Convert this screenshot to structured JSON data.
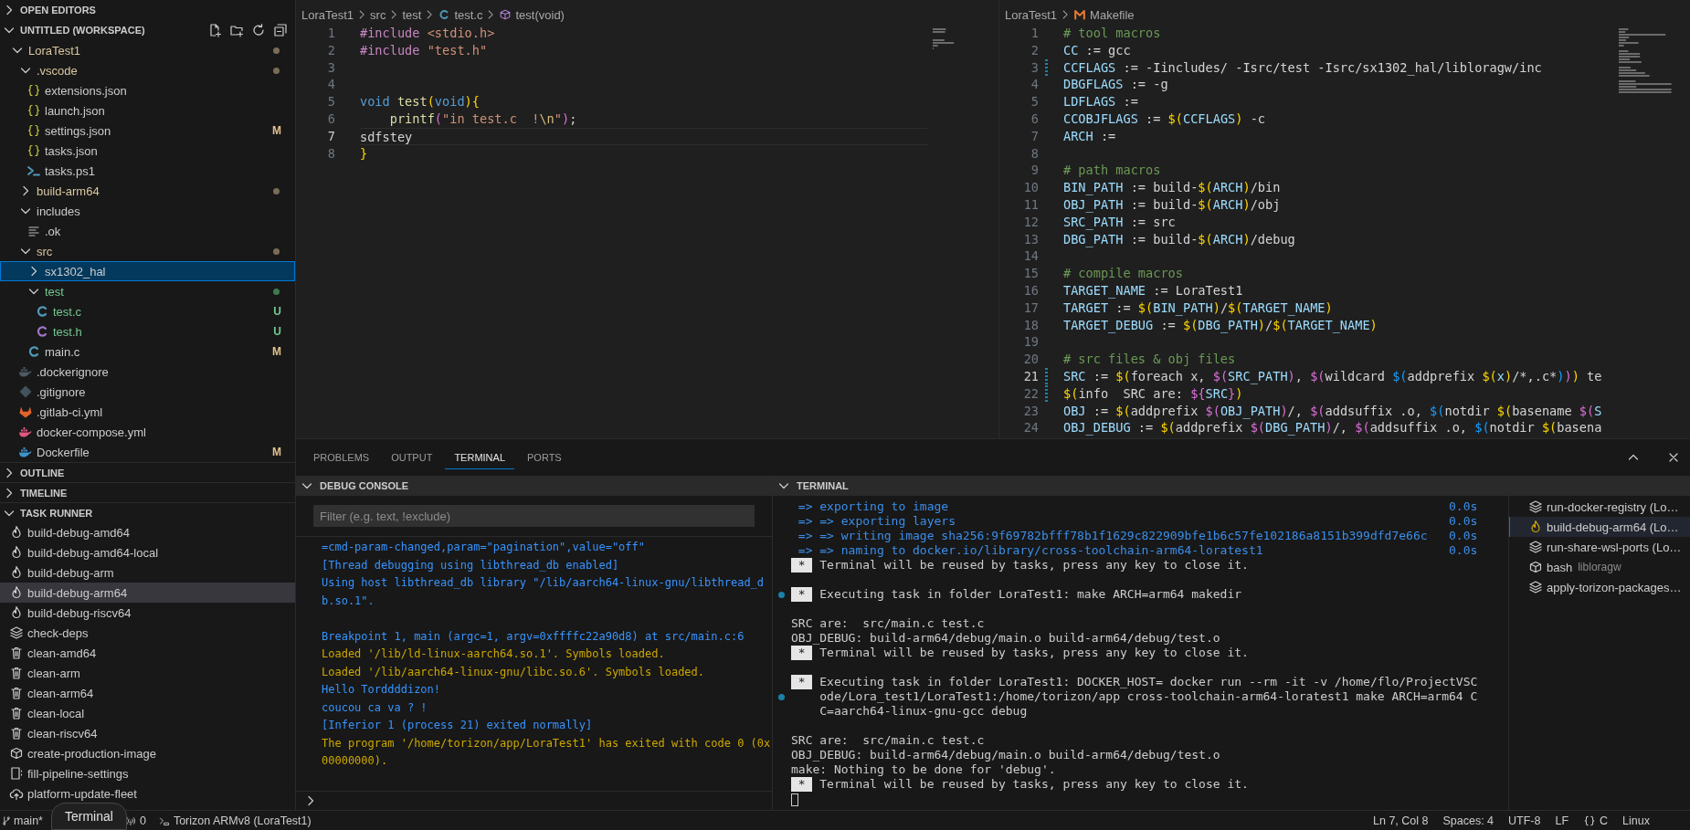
{
  "explorer": {
    "open_editors": {
      "title": "OPEN EDITORS",
      "expanded": false
    },
    "workspace": {
      "title": "UNTITLED (WORKSPACE)",
      "expanded": true
    },
    "tree": [
      {
        "name": "LoraTest1",
        "kind": "folder",
        "expanded": true,
        "color": "#7a6c55",
        "selected": false,
        "children": [
          {
            "name": ".vscode",
            "kind": "folder",
            "expanded": true,
            "color": "#7a6c55",
            "selected": false,
            "children": [
              {
                "name": "extensions.json",
                "kind": "json",
                "selected": false
              },
              {
                "name": "launch.json",
                "kind": "json",
                "selected": false
              },
              {
                "name": "settings.json",
                "kind": "json",
                "badge": "M",
                "untracked": false,
                "selected": false
              },
              {
                "name": "tasks.json",
                "kind": "json",
                "selected": false
              },
              {
                "name": "tasks.ps1",
                "kind": "powershell",
                "selected": false
              }
            ]
          },
          {
            "name": "build-arm64",
            "kind": "folder",
            "expanded": false,
            "color": "#7a6c55",
            "selected": false
          },
          {
            "name": "includes",
            "kind": "folder",
            "expanded": true,
            "selected": false,
            "children": [
              {
                "name": ".ok",
                "kind": "text",
                "selected": false
              }
            ]
          },
          {
            "name": "src",
            "kind": "folder",
            "expanded": true,
            "color": "#7a6c55",
            "selected": false,
            "children": [
              {
                "name": "sx1302_hal",
                "kind": "folder",
                "expanded": false,
                "selected": true
              },
              {
                "name": "test",
                "kind": "folder",
                "expanded": true,
                "color": "#3f7a50",
                "untracked": true,
                "selected": false,
                "children": [
                  {
                    "name": "test.c",
                    "kind": "c",
                    "badge": "U",
                    "untracked": true,
                    "selected": false
                  },
                  {
                    "name": "test.h",
                    "kind": "h",
                    "badge": "U",
                    "untracked": true,
                    "selected": false
                  }
                ]
              },
              {
                "name": "main.c",
                "kind": "c",
                "badge": "M",
                "untracked": false,
                "selected": false
              }
            ]
          },
          {
            "name": ".dockerignore",
            "kind": "docker-ignore",
            "selected": false
          },
          {
            "name": ".gitignore",
            "kind": "git",
            "selected": false
          },
          {
            "name": ".gitlab-ci.yml",
            "kind": "gitlab",
            "selected": false
          },
          {
            "name": "docker-compose.yml",
            "kind": "compose",
            "selected": false
          },
          {
            "name": "Dockerfile",
            "kind": "docker",
            "badge": "M",
            "untracked": false,
            "selected": false
          }
        ]
      }
    ]
  },
  "outline": {
    "title": "OUTLINE",
    "expanded": false
  },
  "timeline": {
    "title": "TIMELINE",
    "expanded": false
  },
  "task_runner": {
    "title": "TASK RUNNER",
    "expanded": true,
    "tasks": [
      {
        "name": "build-debug-amd64",
        "kind": "flame",
        "selected": false
      },
      {
        "name": "build-debug-amd64-local",
        "kind": "flame",
        "selected": false
      },
      {
        "name": "build-debug-arm",
        "kind": "flame",
        "selected": false
      },
      {
        "name": "build-debug-arm64",
        "kind": "flame",
        "selected": true
      },
      {
        "name": "build-debug-riscv64",
        "kind": "flame",
        "selected": false
      },
      {
        "name": "check-deps",
        "kind": "layers",
        "selected": false
      },
      {
        "name": "clean-amd64",
        "kind": "trash",
        "selected": false
      },
      {
        "name": "clean-arm",
        "kind": "trash",
        "selected": false
      },
      {
        "name": "clean-arm64",
        "kind": "trash",
        "selected": false
      },
      {
        "name": "clean-local",
        "kind": "trash",
        "selected": false
      },
      {
        "name": "clean-riscv64",
        "kind": "trash",
        "selected": false
      },
      {
        "name": "create-production-image",
        "kind": "box",
        "selected": false
      },
      {
        "name": "fill-pipeline-settings",
        "kind": "form",
        "selected": false
      },
      {
        "name": "platform-update-fleet",
        "kind": "cloud",
        "selected": false
      }
    ]
  },
  "editors": [
    {
      "focused": true,
      "breadcrumb": [
        {
          "text": "LoraTest1"
        },
        {
          "text": "src"
        },
        {
          "text": "test"
        },
        {
          "text": "test.c",
          "kind": "c"
        },
        {
          "text": "test(void)",
          "kind": "method"
        }
      ],
      "lines": [
        {
          "number": "1",
          "current": false,
          "tokens": [
            {
              "kind": "directive",
              "text": "#include"
            },
            {
              "kind": "string",
              "text": " <stdio.h>"
            }
          ]
        },
        {
          "number": "2",
          "current": false,
          "tokens": [
            {
              "kind": "directive",
              "text": "#include"
            },
            {
              "kind": "string",
              "text": " \"test.h\""
            }
          ]
        },
        {
          "number": "3",
          "current": false
        },
        {
          "number": "4",
          "current": false
        },
        {
          "number": "5",
          "current": false,
          "tokens": [
            {
              "kind": "keyword",
              "text": "void"
            },
            {
              "kind": "function",
              "text": " test"
            },
            {
              "kind": "bracket1",
              "text": "("
            },
            {
              "kind": "keyword",
              "text": "void"
            },
            {
              "kind": "bracket1",
              "text": "){"
            }
          ]
        },
        {
          "number": "6",
          "current": false,
          "tokens": [
            {
              "kind": "function",
              "text": "    printf"
            },
            {
              "kind": "bracket2",
              "text": "("
            },
            {
              "kind": "string",
              "text": "\"in test.c  !"
            },
            {
              "kind": "escape",
              "text": "\\n"
            },
            {
              "kind": "string",
              "text": "\""
            },
            {
              "kind": "bracket2",
              "text": ")"
            },
            {
              "kind": "plain",
              "text": ";"
            }
          ]
        },
        {
          "number": "7",
          "current": true,
          "tokens": [
            {
              "kind": "plain",
              "text": "sdfstey"
            }
          ]
        },
        {
          "number": "8",
          "current": false,
          "tokens": [
            {
              "kind": "bracket1",
              "text": "}"
            }
          ]
        }
      ]
    },
    {
      "focused": false,
      "breadcrumb": [
        {
          "text": "LoraTest1"
        },
        {
          "text": "Makefile",
          "kind": "makefile"
        }
      ],
      "lines": [
        {
          "number": "1",
          "current": false,
          "tokens": [
            {
              "kind": "comment",
              "text": "# tool macros"
            }
          ]
        },
        {
          "number": "2",
          "current": false,
          "tokens": [
            {
              "kind": "variable",
              "text": "CC"
            },
            {
              "kind": "plain",
              "text": " := gcc"
            }
          ]
        },
        {
          "number": "3",
          "current": false,
          "modified": true,
          "tokens": [
            {
              "kind": "variable",
              "text": "CCFLAGS"
            },
            {
              "kind": "plain",
              "text": " := -Iincludes/ -Isrc/test -Isrc/sx1302_hal/libloragw/inc"
            }
          ]
        },
        {
          "number": "4",
          "current": false,
          "tokens": [
            {
              "kind": "variable",
              "text": "DBGFLAGS"
            },
            {
              "kind": "plain",
              "text": " := -g"
            }
          ]
        },
        {
          "number": "5",
          "current": false,
          "tokens": [
            {
              "kind": "variable",
              "text": "LDFLAGS"
            },
            {
              "kind": "plain",
              "text": " :="
            }
          ]
        },
        {
          "number": "6",
          "current": false,
          "tokens": [
            {
              "kind": "variable",
              "text": "CCOBJFLAGS"
            },
            {
              "kind": "plain",
              "text": " := "
            },
            {
              "kind": "bracket1",
              "text": "$("
            },
            {
              "kind": "variable",
              "text": "CCFLAGS"
            },
            {
              "kind": "bracket1",
              "text": ")"
            },
            {
              "kind": "plain",
              "text": " -c"
            }
          ]
        },
        {
          "number": "7",
          "current": false,
          "tokens": [
            {
              "kind": "variable",
              "text": "ARCH"
            },
            {
              "kind": "plain",
              "text": " :="
            }
          ]
        },
        {
          "number": "8",
          "current": false
        },
        {
          "number": "9",
          "current": false,
          "tokens": [
            {
              "kind": "comment",
              "text": "# path macros"
            }
          ]
        },
        {
          "number": "10",
          "current": false,
          "tokens": [
            {
              "kind": "variable",
              "text": "BIN_PATH"
            },
            {
              "kind": "plain",
              "text": " := build-"
            },
            {
              "kind": "bracket1",
              "text": "$("
            },
            {
              "kind": "variable",
              "text": "ARCH"
            },
            {
              "kind": "bracket1",
              "text": ")"
            },
            {
              "kind": "plain",
              "text": "/bin"
            }
          ]
        },
        {
          "number": "11",
          "current": false,
          "tokens": [
            {
              "kind": "variable",
              "text": "OBJ_PATH"
            },
            {
              "kind": "plain",
              "text": " := build-"
            },
            {
              "kind": "bracket1",
              "text": "$("
            },
            {
              "kind": "variable",
              "text": "ARCH"
            },
            {
              "kind": "bracket1",
              "text": ")"
            },
            {
              "kind": "plain",
              "text": "/obj"
            }
          ]
        },
        {
          "number": "12",
          "current": false,
          "tokens": [
            {
              "kind": "variable",
              "text": "SRC_PATH"
            },
            {
              "kind": "plain",
              "text": " := src"
            }
          ]
        },
        {
          "number": "13",
          "current": false,
          "tokens": [
            {
              "kind": "variable",
              "text": "DBG_PATH"
            },
            {
              "kind": "plain",
              "text": " := build-"
            },
            {
              "kind": "bracket1",
              "text": "$("
            },
            {
              "kind": "variable",
              "text": "ARCH"
            },
            {
              "kind": "bracket1",
              "text": ")"
            },
            {
              "kind": "plain",
              "text": "/debug"
            }
          ]
        },
        {
          "number": "14",
          "current": false
        },
        {
          "number": "15",
          "current": false,
          "tokens": [
            {
              "kind": "comment",
              "text": "# compile macros"
            }
          ]
        },
        {
          "number": "16",
          "current": false,
          "tokens": [
            {
              "kind": "variable",
              "text": "TARGET_NAME"
            },
            {
              "kind": "plain",
              "text": " := LoraTest1"
            }
          ]
        },
        {
          "number": "17",
          "current": false,
          "tokens": [
            {
              "kind": "variable",
              "text": "TARGET"
            },
            {
              "kind": "plain",
              "text": " := "
            },
            {
              "kind": "bracket1",
              "text": "$("
            },
            {
              "kind": "variable",
              "text": "BIN_PATH"
            },
            {
              "kind": "bracket1",
              "text": ")"
            },
            {
              "kind": "plain",
              "text": "/"
            },
            {
              "kind": "bracket1",
              "text": "$("
            },
            {
              "kind": "variable",
              "text": "TARGET_NAME"
            },
            {
              "kind": "bracket1",
              "text": ")"
            }
          ]
        },
        {
          "number": "18",
          "current": false,
          "tokens": [
            {
              "kind": "variable",
              "text": "TARGET_DEBUG"
            },
            {
              "kind": "plain",
              "text": " := "
            },
            {
              "kind": "bracket1",
              "text": "$("
            },
            {
              "kind": "variable",
              "text": "DBG_PATH"
            },
            {
              "kind": "bracket1",
              "text": ")"
            },
            {
              "kind": "plain",
              "text": "/"
            },
            {
              "kind": "bracket1",
              "text": "$("
            },
            {
              "kind": "variable",
              "text": "TARGET_NAME"
            },
            {
              "kind": "bracket1",
              "text": ")"
            }
          ]
        },
        {
          "number": "19",
          "current": false
        },
        {
          "number": "20",
          "current": false,
          "tokens": [
            {
              "kind": "comment",
              "text": "# src files & obj files"
            }
          ]
        },
        {
          "number": "21",
          "current": true,
          "modified": true,
          "tokens": [
            {
              "kind": "variable",
              "text": "SRC"
            },
            {
              "kind": "plain",
              "text": " := "
            },
            {
              "kind": "bracket1",
              "text": "$("
            },
            {
              "kind": "plain",
              "text": "foreach x, "
            },
            {
              "kind": "bracket2",
              "text": "$("
            },
            {
              "kind": "variable",
              "text": "SRC_PATH"
            },
            {
              "kind": "bracket2",
              "text": ")"
            },
            {
              "kind": "plain",
              "text": ", "
            },
            {
              "kind": "bracket2",
              "text": "$("
            },
            {
              "kind": "plain",
              "text": "wildcard "
            },
            {
              "kind": "bracket3",
              "text": "$("
            },
            {
              "kind": "plain",
              "text": "addprefix "
            },
            {
              "kind": "bracket1",
              "text": "$("
            },
            {
              "kind": "variable",
              "text": "x"
            },
            {
              "kind": "bracket1",
              "text": ")"
            },
            {
              "kind": "plain",
              "text": "/*,.c*"
            },
            {
              "kind": "bracket3",
              "text": ")"
            },
            {
              "kind": "bracket2",
              "text": ")"
            },
            {
              "kind": "bracket1",
              "text": ")"
            },
            {
              "kind": "plain",
              "text": " te"
            }
          ]
        },
        {
          "number": "22",
          "current": false,
          "modified": true,
          "tokens": [
            {
              "kind": "bracket1",
              "text": "$("
            },
            {
              "kind": "plain",
              "text": "info  SRC are: "
            },
            {
              "kind": "bracket2",
              "text": "${"
            },
            {
              "kind": "variable",
              "text": "SRC"
            },
            {
              "kind": "bracket2",
              "text": "}"
            },
            {
              "kind": "bracket1",
              "text": ")"
            }
          ]
        },
        {
          "number": "23",
          "current": false,
          "tokens": [
            {
              "kind": "variable",
              "text": "OBJ"
            },
            {
              "kind": "plain",
              "text": " := "
            },
            {
              "kind": "bracket1",
              "text": "$("
            },
            {
              "kind": "plain",
              "text": "addprefix "
            },
            {
              "kind": "bracket2",
              "text": "$("
            },
            {
              "kind": "variable",
              "text": "OBJ_PATH"
            },
            {
              "kind": "bracket2",
              "text": ")"
            },
            {
              "kind": "plain",
              "text": "/, "
            },
            {
              "kind": "bracket2",
              "text": "$("
            },
            {
              "kind": "plain",
              "text": "addsuffix .o, "
            },
            {
              "kind": "bracket3",
              "text": "$("
            },
            {
              "kind": "plain",
              "text": "notdir "
            },
            {
              "kind": "bracket1",
              "text": "$("
            },
            {
              "kind": "plain",
              "text": "basename "
            },
            {
              "kind": "bracket2",
              "text": "$("
            },
            {
              "kind": "variable",
              "text": "S"
            }
          ]
        },
        {
          "number": "24",
          "current": false,
          "tokens": [
            {
              "kind": "variable",
              "text": "OBJ_DEBUG"
            },
            {
              "kind": "plain",
              "text": " := "
            },
            {
              "kind": "bracket1",
              "text": "$("
            },
            {
              "kind": "plain",
              "text": "addprefix "
            },
            {
              "kind": "bracket2",
              "text": "$("
            },
            {
              "kind": "variable",
              "text": "DBG_PATH"
            },
            {
              "kind": "bracket2",
              "text": ")"
            },
            {
              "kind": "plain",
              "text": "/, "
            },
            {
              "kind": "bracket2",
              "text": "$("
            },
            {
              "kind": "plain",
              "text": "addsuffix .o, "
            },
            {
              "kind": "bracket3",
              "text": "$("
            },
            {
              "kind": "plain",
              "text": "notdir "
            },
            {
              "kind": "bracket1",
              "text": "$("
            },
            {
              "kind": "plain",
              "text": "basena"
            }
          ]
        }
      ]
    }
  ],
  "panel_tabs": [
    {
      "label": "PROBLEMS",
      "selected": false
    },
    {
      "label": "OUTPUT",
      "selected": false
    },
    {
      "label": "TERMINAL",
      "selected": true
    },
    {
      "label": "PORTS",
      "selected": false
    }
  ],
  "debug_console": {
    "title": "DEBUG CONSOLE",
    "expanded": true,
    "filter": {
      "placeholder": "Filter (e.g. text, !exclude)"
    },
    "lines": [
      {
        "kind": "info",
        "text": "=cmd-param-changed,param=\"pagination\",value=\"off\""
      },
      {
        "kind": "info",
        "text": "[Thread debugging using libthread_db enabled]"
      },
      {
        "kind": "info",
        "text": "Using host libthread_db library \"/lib/aarch64-linux-gnu/libthread_db.so.1\"."
      },
      {
        "kind": "blank"
      },
      {
        "kind": "info",
        "text": "Breakpoint 1, main (argc=1, argv=0xffffc22a90d8) at src/main.c:6"
      },
      {
        "kind": "warn",
        "text": "Loaded '/lib/ld-linux-aarch64.so.1'. Symbols loaded."
      },
      {
        "kind": "warn",
        "text": "Loaded '/lib/aarch64-linux-gnu/libc.so.6'. Symbols loaded."
      },
      {
        "kind": "info",
        "text": "Hello Torddddizon!"
      },
      {
        "kind": "info",
        "text": "coucou ca va ? !"
      },
      {
        "kind": "info",
        "text": "[Inferior 1 (process 21) exited normally]"
      },
      {
        "kind": "warn",
        "text": "The program '/home/torizon/app/LoraTest1' has exited with code 0 (0x00000000)."
      }
    ]
  },
  "terminal": {
    "title": "TERMINAL",
    "expanded": true,
    "lines": [
      {
        "kind": "progress",
        "text": "=> exporting to image",
        "time": "0.0s"
      },
      {
        "kind": "progress",
        "text": "=> => exporting layers",
        "time": "0.0s"
      },
      {
        "kind": "progress",
        "text": "=> => writing image sha256:9f69782bfff78b1f1629c822909bfe1b6c57fe102186a8151b399dfd7e66c",
        "time": "0.0s"
      },
      {
        "kind": "progress",
        "text": "=> => naming to docker.io/library/cross-toolchain-arm64-loratest1",
        "time": "0.0s"
      },
      {
        "kind": "notice",
        "badge": "*",
        "text": "Terminal will be reused by tasks, press any key to close it."
      },
      {
        "kind": "blank"
      },
      {
        "kind": "task",
        "badge": "*",
        "text": "Executing task in folder LoraTest1: make ARCH=arm64 makedir"
      },
      {
        "kind": "blank"
      },
      {
        "kind": "plain",
        "text": "SRC are:  src/main.c test.c"
      },
      {
        "kind": "plain",
        "text": "OBJ_DEBUG: build-arm64/debug/main.o build-arm64/debug/test.o"
      },
      {
        "kind": "notice",
        "badge": "*",
        "text": "Terminal will be reused by tasks, press any key to close it."
      },
      {
        "kind": "blank"
      },
      {
        "kind": "task",
        "badge": "*",
        "text": "Executing task in folder LoraTest1: DOCKER_HOST= docker run --rm -it -v /home/flo/ProjectVSCode/Lora_test1/LoraTest1:/home/torizon/app cross-toolchain-arm64-loratest1 make ARCH=arm64 CC=aarch64-linux-gnu-gcc debug"
      },
      {
        "kind": "blank"
      },
      {
        "kind": "plain",
        "text": "SRC are:  src/main.c test.c"
      },
      {
        "kind": "plain",
        "text": "OBJ_DEBUG: build-arm64/debug/main.o build-arm64/debug/test.o"
      },
      {
        "kind": "plain",
        "text": "make: Nothing to be done for 'debug'."
      },
      {
        "kind": "notice",
        "badge": "*",
        "text": "Terminal will be reused by tasks, press any key to close it."
      },
      {
        "kind": "cursor"
      }
    ],
    "tabs": [
      {
        "label": "run-docker-registry (Lo…",
        "kind": "layers",
        "selected": false
      },
      {
        "label": "build-debug-arm64 (Lo…",
        "kind": "flame",
        "selected": true
      },
      {
        "label": "run-share-wsl-ports (Lo…",
        "kind": "layers",
        "selected": false
      },
      {
        "label": "bash",
        "detail": "libloragw",
        "kind": "box",
        "selected": false
      },
      {
        "label": "apply-torizon-packages…",
        "kind": "layers",
        "selected": false
      }
    ]
  },
  "status_bar": {
    "left": [
      {
        "kind": "branch",
        "text": "main*"
      },
      {
        "kind": "ports",
        "text": "0"
      },
      {
        "kind": "torizon",
        "text": "Torizon ARMv8 (LoraTest1)"
      }
    ],
    "right": [
      {
        "text": "Ln 7, Col 8"
      },
      {
        "text": "Spaces: 4"
      },
      {
        "text": "UTF-8"
      },
      {
        "text": "LF"
      },
      {
        "kind": "braces",
        "text": "C"
      },
      {
        "text": "Linux"
      }
    ],
    "tooltip": "Terminal"
  }
}
